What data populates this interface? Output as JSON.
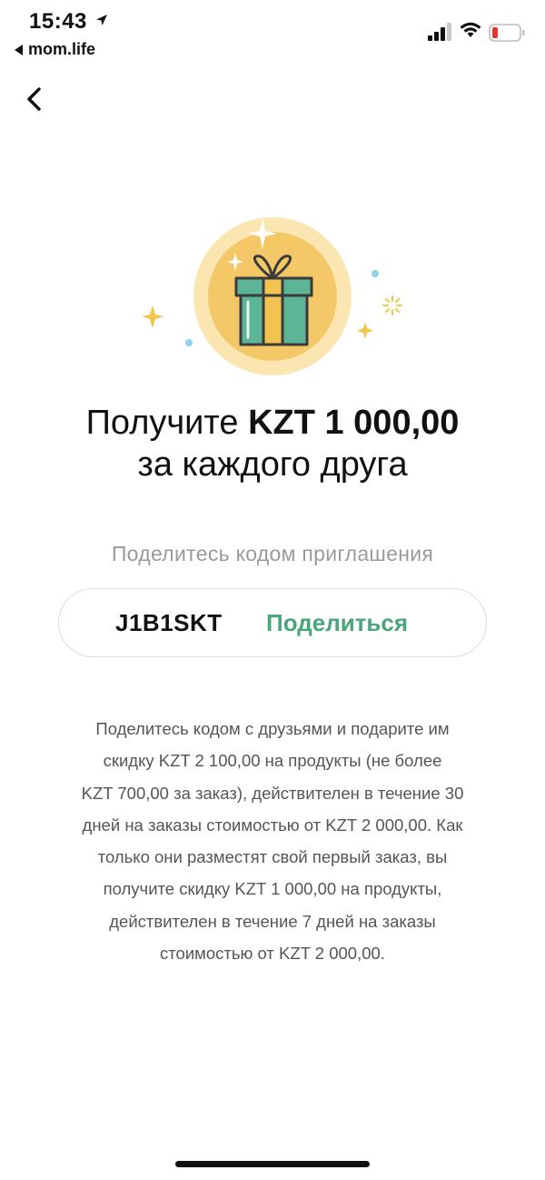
{
  "status_bar": {
    "time": "15:43",
    "back_app": "mom.life",
    "icons": [
      "location-arrow-icon",
      "cellular-signal-icon",
      "wifi-icon",
      "battery-low-icon"
    ],
    "battery_color": "#e0362c"
  },
  "nav": {
    "back_icon": "chevron-left-icon"
  },
  "illustration": {
    "icon": "gift-icon",
    "colors": {
      "circle_outer": "#fbe6b2",
      "circle_inner": "#f4c866",
      "gift_green": "#5cb596",
      "ribbon_yellow": "#f2c34e",
      "sparkle": "#f1c44a",
      "dot_blue": "#8fd3ea"
    }
  },
  "headline": {
    "line1_prefix": "Получите ",
    "line1_amount": "KZT 1 000,00",
    "line2": "за каждого друга"
  },
  "invite": {
    "label": "Поделитесь кодом приглашения",
    "code": "J1B1SKT",
    "share_button": "Поделиться",
    "accent_color": "#4ba57a"
  },
  "description": {
    "lines": [
      "Поделитесь кодом с друзьями и подарите им",
      "скидку KZT 2 100,00 на продукты (не более",
      "KZT 700,00 за заказ), действителен в течение 30",
      "дней на заказы стоимостью от KZT 2 000,00. Как",
      "только они разместят свой первый заказ, вы",
      "получите скидку KZT 1 000,00 на продукты,",
      "действителен в течение 7 дней на заказы",
      "стоимостью от KZT 2 000,00."
    ]
  }
}
